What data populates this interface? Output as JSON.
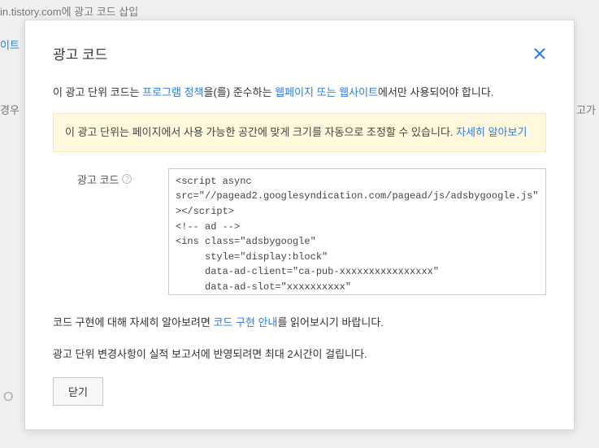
{
  "background": {
    "line1": "in.tistory.com에 광고 코드 삽입",
    "line2": "이트",
    "line3": "경우",
    "line4": "고가",
    "line5": "O"
  },
  "modal": {
    "title": "광고 코드",
    "policy": {
      "prefix": "이 광고 단위 코드는 ",
      "link1": "프로그램 정책",
      "mid1": "을(를) 준수하는 ",
      "link2": "웹페이지 또는 웹사이트",
      "suffix": "에서만 사용되어야 합니다."
    },
    "notice": {
      "text": "이 광고 단위는 페이지에서 사용 가능한 공간에 맞게 크기를 자동으로 조정할 수 있습니다.  ",
      "link": "자세히 알아보기"
    },
    "code_label": "광고 코드",
    "help_icon": "?",
    "code_content": "<script async src=\"//pagead2.googlesyndication.com/pagead/js/adsbygoogle.js\"></script>\n<!-- ad -->\n<ins class=\"adsbygoogle\"\n     style=\"display:block\"\n     data-ad-client=\"ca-pub-xxxxxxxxxxxxxxxx\"\n     data-ad-slot=\"xxxxxxxxxx\"\n     data-ad-format=\"auto\"></ins>",
    "implementation": {
      "prefix": "코드 구현에 대해 자세히 알아보려면 ",
      "link": "코드 구현 안내",
      "suffix": "를 읽어보시기 바랍니다."
    },
    "delay_note": "광고 단위 변경사항이 실적 보고서에 반영되려면 최대 2시간이 걸립니다.",
    "close_button": "닫기"
  }
}
